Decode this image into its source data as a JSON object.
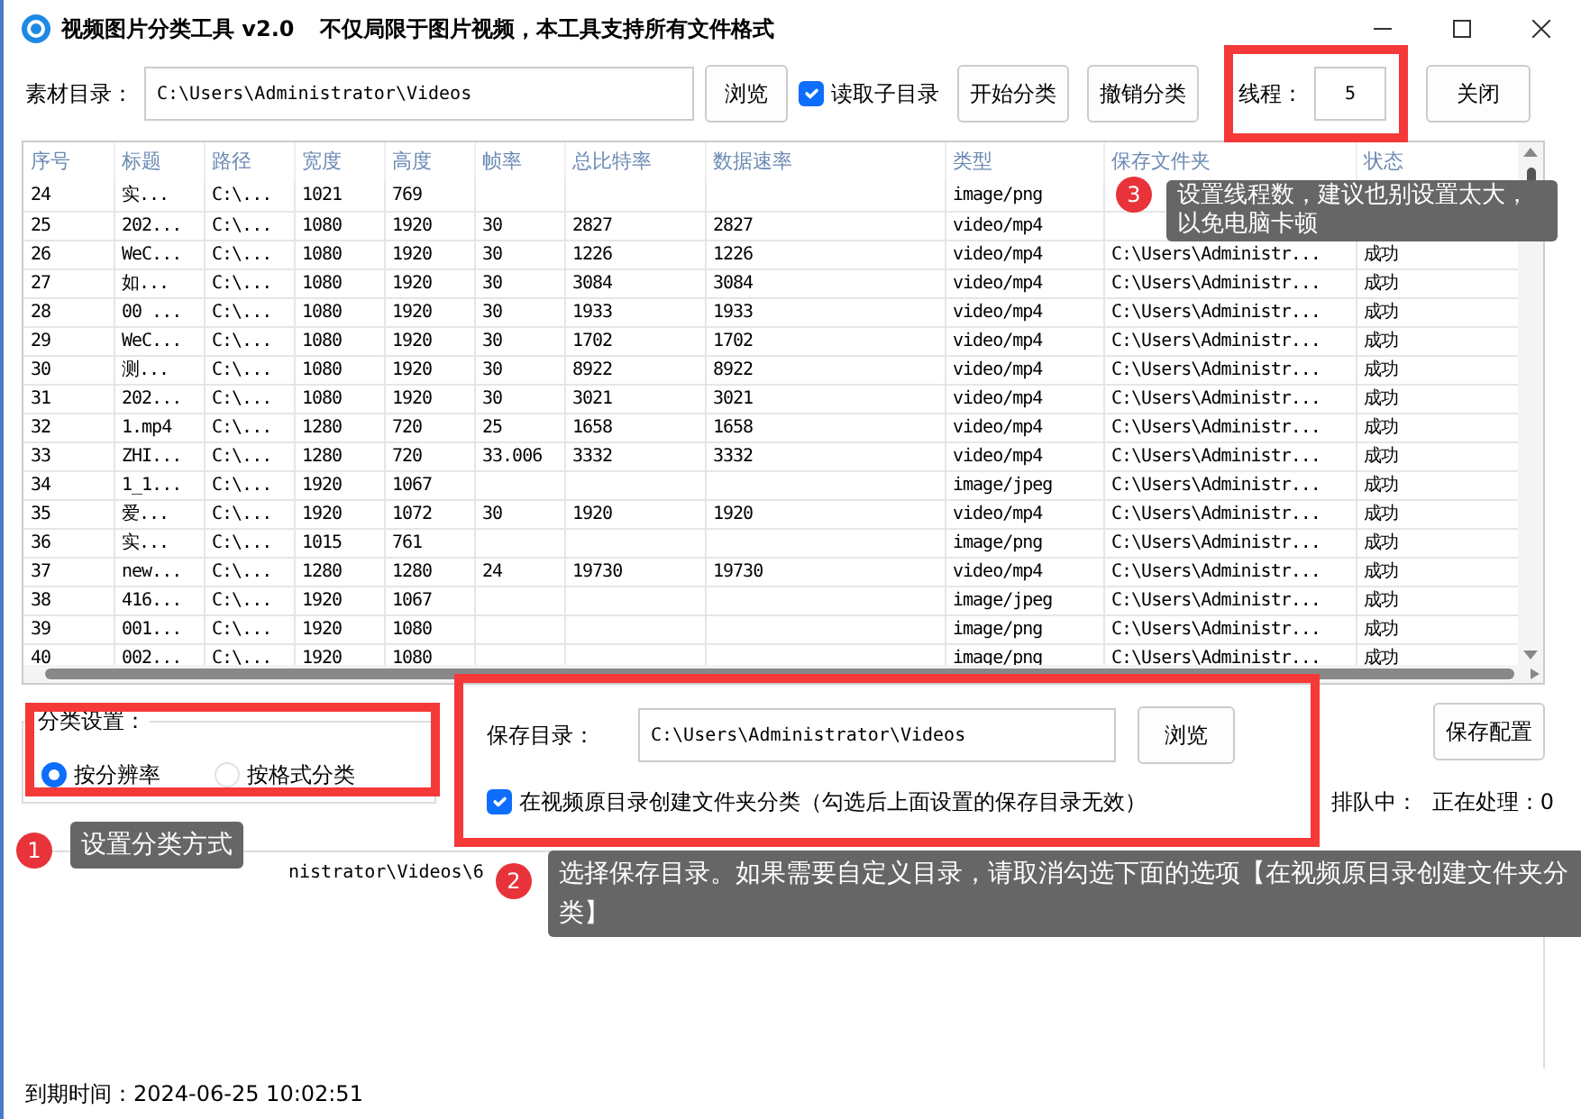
{
  "window": {
    "title": "视频图片分类工具 v2.0",
    "subtitle": "不仅局限于图片视频，本工具支持所有文件格式"
  },
  "toolbar": {
    "source_label": "素材目录：",
    "source_path": "C:\\Users\\Administrator\\Videos",
    "browse": "浏览",
    "subdirs": {
      "label": "读取子目录",
      "checked": true
    },
    "start": "开始分类",
    "undo": "撤销分类",
    "threads_label": "线程：",
    "threads": "5",
    "close": "关闭"
  },
  "table": {
    "columns": [
      "序号",
      "标题",
      "路径",
      "宽度",
      "高度",
      "帧率",
      "总比特率",
      "数据速率",
      "类型",
      "保存文件夹",
      "状态"
    ],
    "rows": [
      [
        "24",
        "实...",
        "C:\\...",
        "1021",
        "769",
        null,
        null,
        null,
        "image/png",
        null,
        null
      ],
      [
        "25",
        "202...",
        "C:\\...",
        "1080",
        "1920",
        "30",
        "2827",
        "2827",
        "video/mp4",
        null,
        null
      ],
      [
        "26",
        "WeC...",
        "C:\\...",
        "1080",
        "1920",
        "30",
        "1226",
        "1226",
        "video/mp4",
        "C:\\Users\\Administr...",
        "成功"
      ],
      [
        "27",
        "如...",
        "C:\\...",
        "1080",
        "1920",
        "30",
        "3084",
        "3084",
        "video/mp4",
        "C:\\Users\\Administr...",
        "成功"
      ],
      [
        "28",
        "00 ...",
        "C:\\...",
        "1080",
        "1920",
        "30",
        "1933",
        "1933",
        "video/mp4",
        "C:\\Users\\Administr...",
        "成功"
      ],
      [
        "29",
        "WeC...",
        "C:\\...",
        "1080",
        "1920",
        "30",
        "1702",
        "1702",
        "video/mp4",
        "C:\\Users\\Administr...",
        "成功"
      ],
      [
        "30",
        "测...",
        "C:\\...",
        "1080",
        "1920",
        "30",
        "8922",
        "8922",
        "video/mp4",
        "C:\\Users\\Administr...",
        "成功"
      ],
      [
        "31",
        "202...",
        "C:\\...",
        "1080",
        "1920",
        "30",
        "3021",
        "3021",
        "video/mp4",
        "C:\\Users\\Administr...",
        "成功"
      ],
      [
        "32",
        "1.mp4",
        "C:\\...",
        "1280",
        "720",
        "25",
        "1658",
        "1658",
        "video/mp4",
        "C:\\Users\\Administr...",
        "成功"
      ],
      [
        "33",
        "ZHI...",
        "C:\\...",
        "1280",
        "720",
        "33.006",
        "3332",
        "3332",
        "video/mp4",
        "C:\\Users\\Administr...",
        "成功"
      ],
      [
        "34",
        "1_1...",
        "C:\\...",
        "1920",
        "1067",
        null,
        null,
        null,
        "image/jpeg",
        "C:\\Users\\Administr...",
        "成功"
      ],
      [
        "35",
        "爱...",
        "C:\\...",
        "1920",
        "1072",
        "30",
        "1920",
        "1920",
        "video/mp4",
        "C:\\Users\\Administr...",
        "成功"
      ],
      [
        "36",
        "实...",
        "C:\\...",
        "1015",
        "761",
        null,
        null,
        null,
        "image/png",
        "C:\\Users\\Administr...",
        "成功"
      ],
      [
        "37",
        "new...",
        "C:\\...",
        "1280",
        "1280",
        "24",
        "19730",
        "19730",
        "video/mp4",
        "C:\\Users\\Administr...",
        "成功"
      ],
      [
        "38",
        "416...",
        "C:\\...",
        "1920",
        "1067",
        null,
        null,
        null,
        "image/jpeg",
        "C:\\Users\\Administr...",
        "成功"
      ],
      [
        "39",
        "001...",
        "C:\\...",
        "1920",
        "1080",
        null,
        null,
        null,
        "image/png",
        "C:\\Users\\Administr...",
        "成功"
      ],
      [
        "40",
        "002...",
        "C:\\...",
        "1920",
        "1080",
        null,
        null,
        null,
        "image/png",
        "C:\\Users\\Administr...",
        "成功"
      ]
    ]
  },
  "classification": {
    "title": "分类设置：",
    "options": [
      {
        "label": "按分辨率",
        "selected": true
      },
      {
        "label": "按格式分类",
        "selected": false
      }
    ]
  },
  "save": {
    "label": "保存目录：",
    "path": "C:\\Users\\Administrator\\Videos",
    "browse": "浏览",
    "save_config": "保存配置",
    "create_folder": {
      "label": "在视频原目录创建文件夹分类（勾选后上面设置的保存目录无效）",
      "checked": true
    },
    "queue": "排队中：",
    "processing": "正在处理：0"
  },
  "log": [
    "nistrator\\Videos\\6"
  ],
  "footer": "到期时间：2024-06-25 10:02:51",
  "annotations": [
    {
      "number": "3",
      "text": "设置线程数，建议也别设置太大，以免电脑卡顿"
    },
    {
      "number": "1",
      "text": "设置分类方式"
    },
    {
      "number": "2",
      "text": "选择保存目录。如果需要自定义目录，请取消勾选下面的选项【在视频原目录创建文件夹分类】"
    }
  ]
}
